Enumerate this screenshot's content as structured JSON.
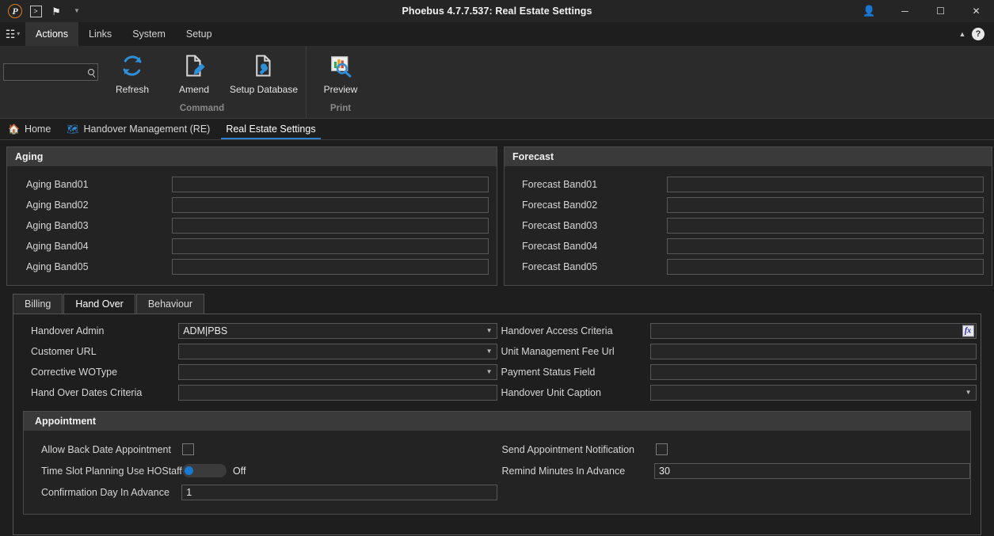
{
  "titlebar": {
    "app_title": "Phoebus 4.7.7.537: Real Estate Settings",
    "logo_glyph": "P",
    "prompt_glyph": ">",
    "bookmark_glyph": "⚑",
    "caret_glyph": "▼",
    "person_glyph": "♟",
    "minimize_glyph": "─",
    "maximize_glyph": "☐",
    "close_glyph": "✕"
  },
  "menubar": {
    "app_menu_glyph": "☰",
    "app_menu_caret": "▾",
    "tabs": [
      {
        "label": "Actions",
        "active": true
      },
      {
        "label": "Links",
        "active": false
      },
      {
        "label": "System",
        "active": false
      },
      {
        "label": "Setup",
        "active": false
      }
    ],
    "collapse_glyph": "▲",
    "help_glyph": "?"
  },
  "ribbon": {
    "search_value": "",
    "search_placeholder": "",
    "groups": [
      {
        "label": "Command",
        "items": [
          {
            "label": "Refresh",
            "icon": "refresh-icon"
          },
          {
            "label": "Amend",
            "icon": "pencil-document-icon"
          },
          {
            "label": "Setup Database",
            "icon": "wrench-document-icon"
          }
        ]
      },
      {
        "label": "Print",
        "items": [
          {
            "label": "Preview",
            "icon": "preview-magnifier-icon"
          }
        ]
      }
    ]
  },
  "doctabs": [
    {
      "label": "Home",
      "icon": "home-icon",
      "selected": false
    },
    {
      "label": "Handover Management (RE)",
      "icon": "handover-icon",
      "selected": false
    },
    {
      "label": "Real Estate Settings",
      "icon": "",
      "selected": true
    }
  ],
  "aging": {
    "title": "Aging",
    "rows": [
      {
        "label": "Aging Band01",
        "value": ""
      },
      {
        "label": "Aging Band02",
        "value": ""
      },
      {
        "label": "Aging Band03",
        "value": ""
      },
      {
        "label": "Aging Band04",
        "value": ""
      },
      {
        "label": "Aging Band05",
        "value": ""
      }
    ]
  },
  "forecast": {
    "title": "Forecast",
    "rows": [
      {
        "label": "Forecast Band01",
        "value": ""
      },
      {
        "label": "Forecast Band02",
        "value": ""
      },
      {
        "label": "Forecast Band03",
        "value": ""
      },
      {
        "label": "Forecast Band04",
        "value": ""
      },
      {
        "label": "Forecast Band05",
        "value": ""
      }
    ]
  },
  "subtabs": [
    {
      "label": "Billing",
      "active": false
    },
    {
      "label": "Hand Over",
      "active": true
    },
    {
      "label": "Behaviour",
      "active": false
    }
  ],
  "handover": {
    "left": [
      {
        "label": "Handover Admin",
        "value": "ADM|PBS",
        "type": "combo"
      },
      {
        "label": "Customer URL",
        "value": "",
        "type": "combo"
      },
      {
        "label": "Corrective WOType",
        "value": "",
        "type": "combo"
      },
      {
        "label": "Hand Over Dates Criteria",
        "value": "",
        "type": "text"
      }
    ],
    "right": [
      {
        "label": "Handover Access Criteria",
        "value": "",
        "type": "fx",
        "fx_label": "fx"
      },
      {
        "label": "Unit Management Fee Url",
        "value": "",
        "type": "text"
      },
      {
        "label": "Payment Status Field",
        "value": "",
        "type": "text"
      },
      {
        "label": "Handover Unit Caption",
        "value": "",
        "type": "combo"
      }
    ]
  },
  "appointment": {
    "title": "Appointment",
    "left": [
      {
        "label": "Allow Back Date Appointment",
        "type": "checkbox",
        "checked": false
      },
      {
        "label": "Time Slot Planning Use HOStaff",
        "type": "toggle",
        "state": "Off"
      },
      {
        "label": "Confirmation Day In Advance",
        "type": "text",
        "value": "1"
      }
    ],
    "right": [
      {
        "label": "Send Appointment Notification",
        "type": "checkbox",
        "checked": false
      },
      {
        "label": "Remind Minutes In Advance",
        "type": "text",
        "value": "30"
      }
    ]
  },
  "colors": {
    "accent": "#2f7fd1",
    "toggle_knob": "#1779d0",
    "logo_ring": "#e07b1e",
    "person": "#4fa882",
    "window_bg": "#1e1e1e",
    "ribbon_bg": "#2b2b2b",
    "panel_head": "#3a3a3a"
  }
}
